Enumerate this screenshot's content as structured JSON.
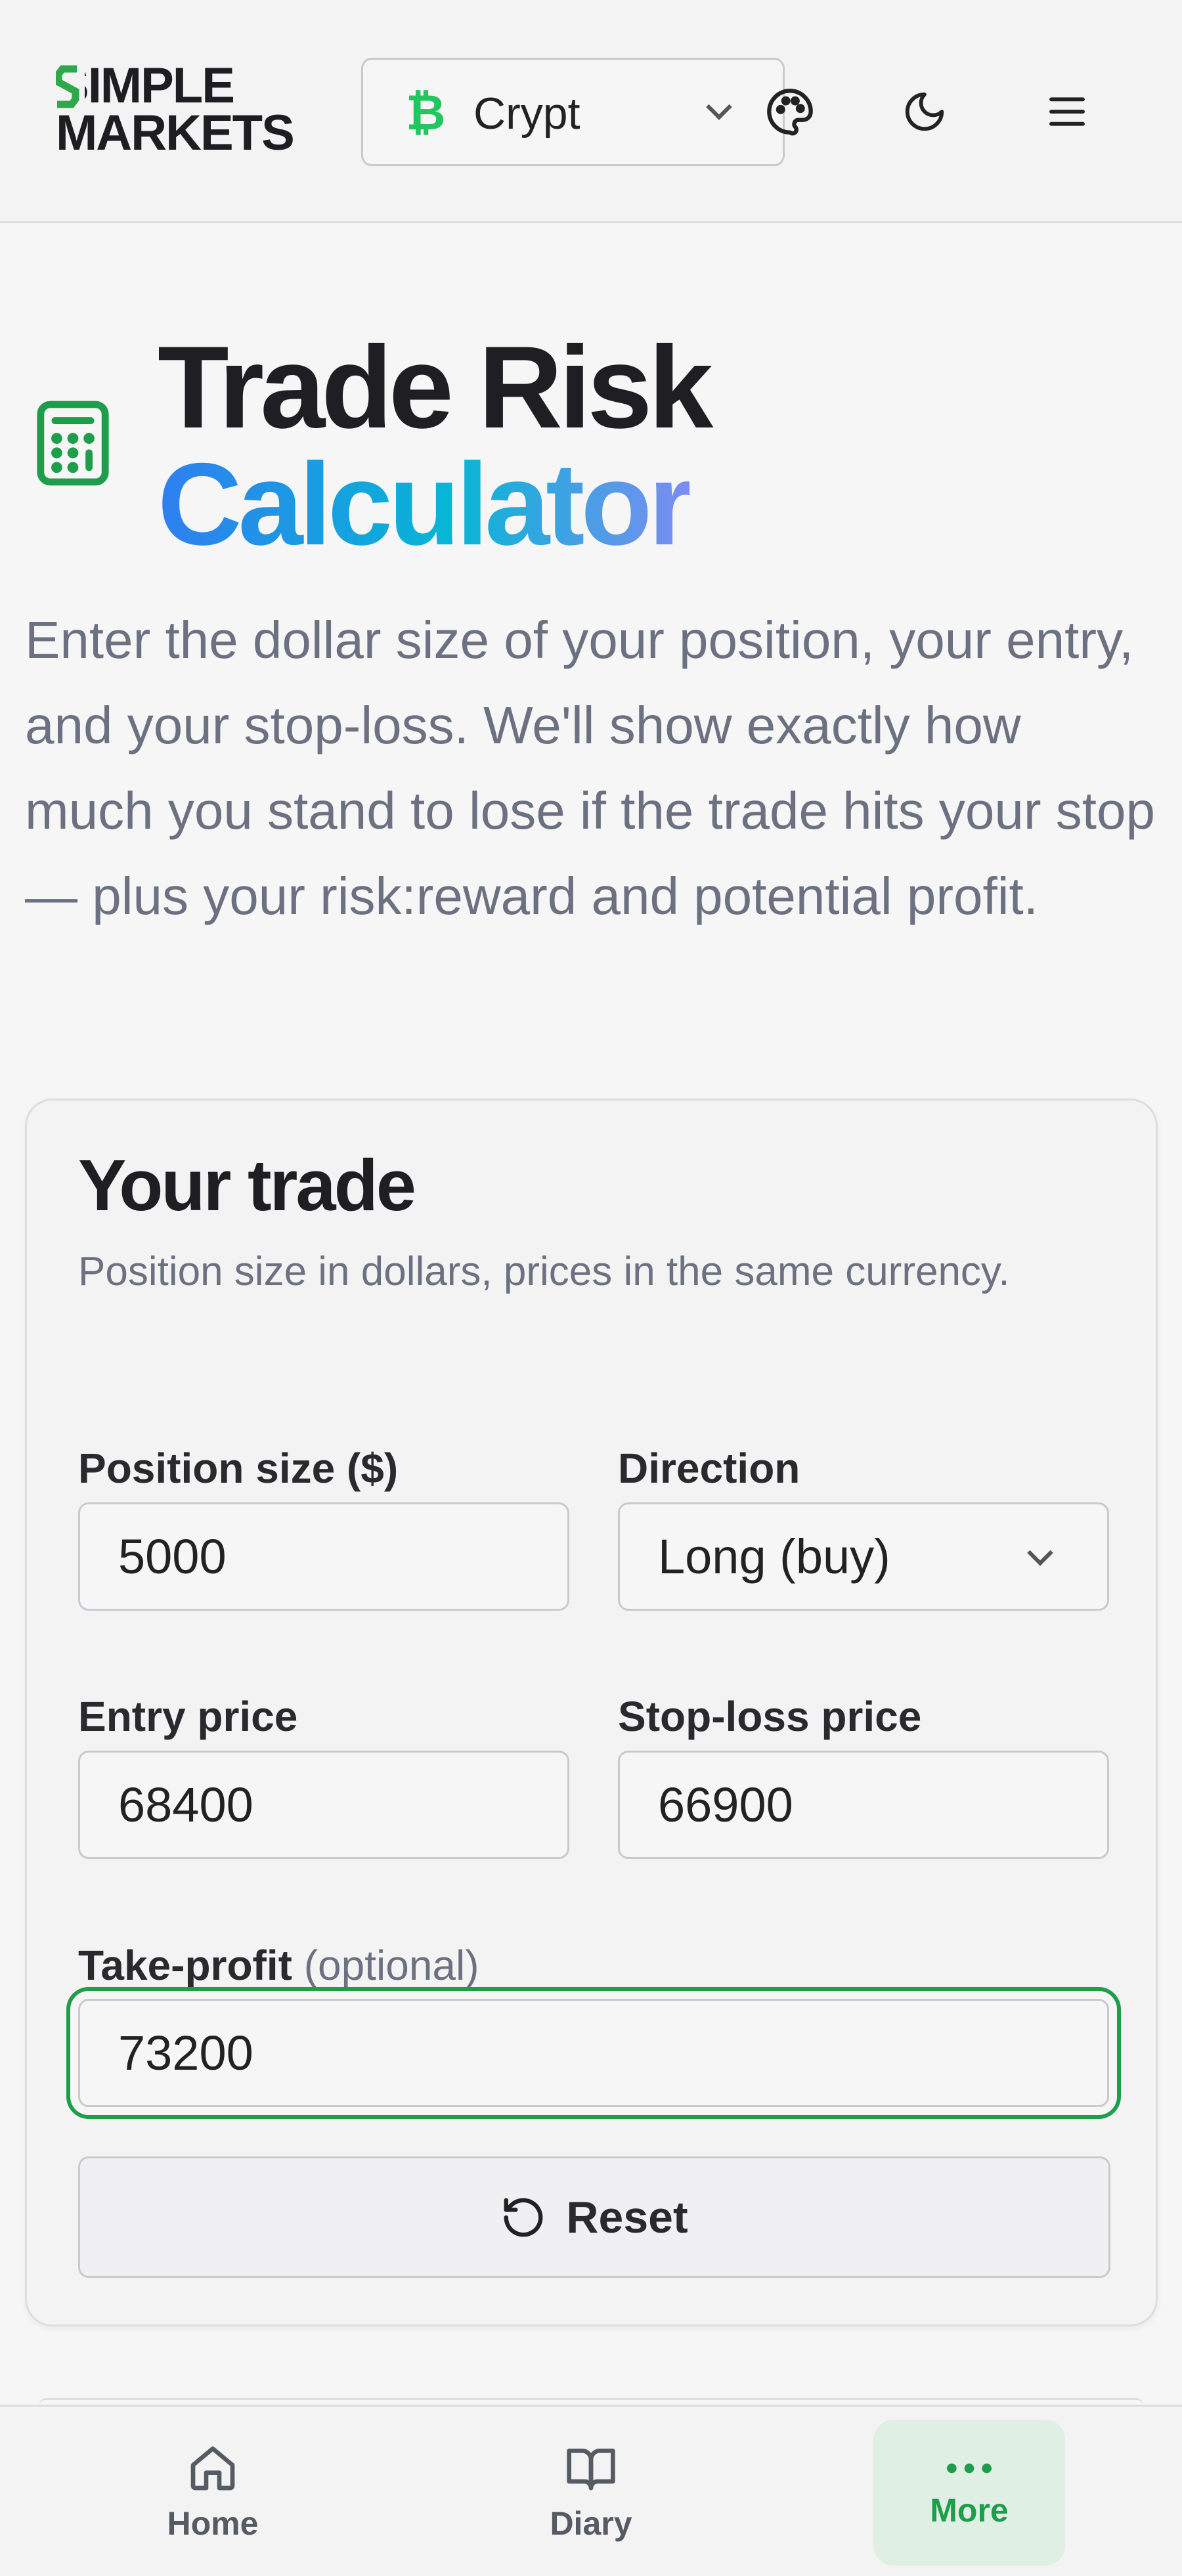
{
  "header": {
    "logo": {
      "line1": "SIMPLE",
      "line2": "MARKETS"
    },
    "market_select": {
      "icon": "bitcoin-icon",
      "value": "Crypt"
    },
    "palette_icon": "palette-icon",
    "theme_icon": "moon-icon",
    "menu_icon": "hamburger-menu-icon"
  },
  "hero": {
    "icon": "calculator-icon",
    "title_line1": "Trade Risk",
    "title_line2": "Calculator",
    "intro": "Enter the dollar size of your position, your entry, and your stop-loss. We'll show exactly how much you stand to lose if the trade hits your stop — plus your risk:reward and potential profit."
  },
  "card": {
    "title": "Your trade",
    "subtitle": "Position size in dollars, prices in the same currency.",
    "position_size": {
      "label": "Position size ($)",
      "value": "5000"
    },
    "direction": {
      "label": "Direction",
      "value": "Long (buy)"
    },
    "entry_price": {
      "label": "Entry price",
      "value": "68400"
    },
    "stop_loss": {
      "label": "Stop-loss price",
      "value": "66900"
    },
    "take_profit": {
      "label": "Take-profit",
      "optional": "(optional)",
      "value": "73200"
    },
    "reset_label": "Reset",
    "reset_icon": "reset-icon"
  },
  "bottom_nav": {
    "items": [
      {
        "label": "Home",
        "icon": "home-icon",
        "active": false
      },
      {
        "label": "Diary",
        "icon": "book-icon",
        "active": false
      },
      {
        "label": "More",
        "icon": "more-dots-icon",
        "active": true
      }
    ]
  },
  "colors": {
    "accent_green": "#1e9e4a",
    "logo_red": "#e11d2d",
    "bitcoin_green": "#22c55e",
    "title_gradient": [
      "#2f7ff0",
      "#06b6d4",
      "#7c8cf2"
    ]
  }
}
